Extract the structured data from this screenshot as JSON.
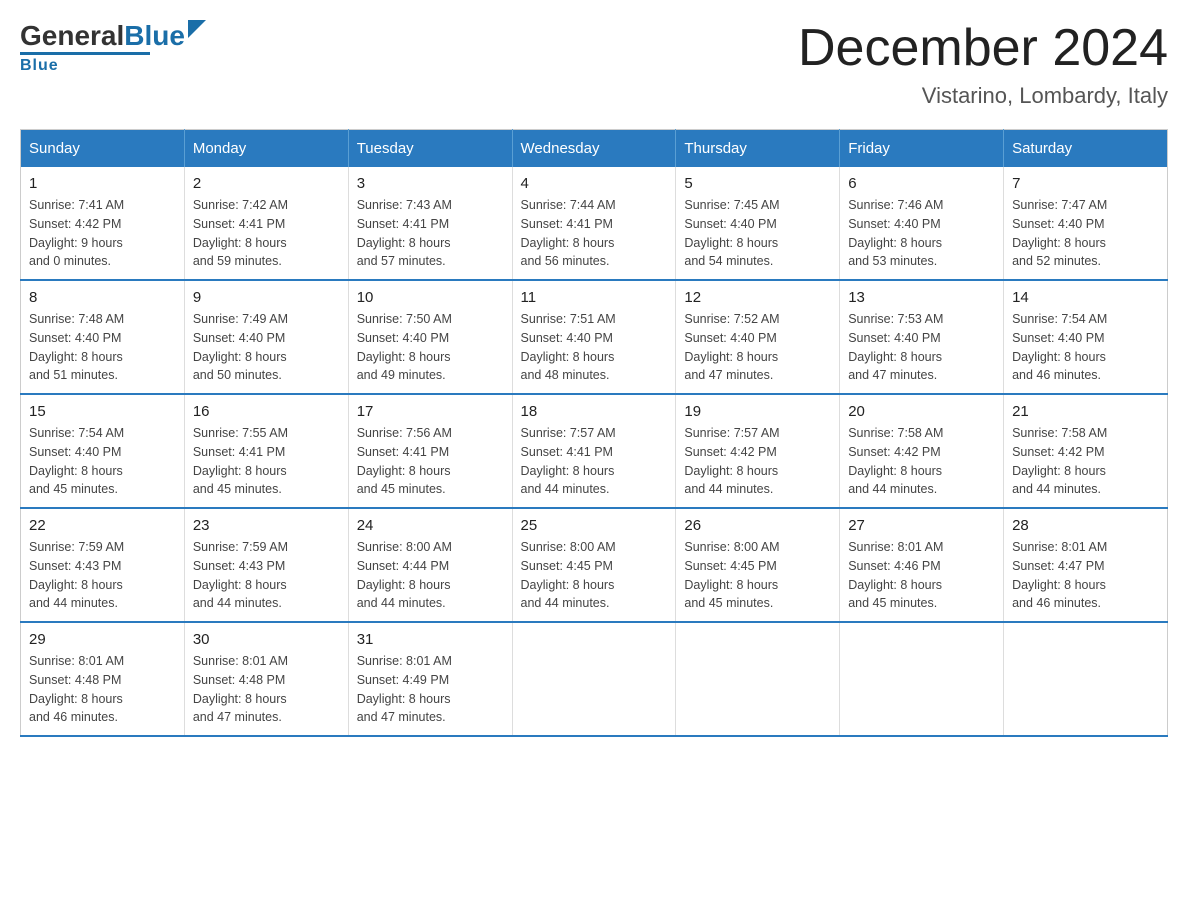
{
  "logo": {
    "general": "General",
    "blue": "Blue"
  },
  "header": {
    "month_year": "December 2024",
    "location": "Vistarino, Lombardy, Italy"
  },
  "days_of_week": [
    "Sunday",
    "Monday",
    "Tuesday",
    "Wednesday",
    "Thursday",
    "Friday",
    "Saturday"
  ],
  "weeks": [
    [
      {
        "day": "1",
        "sunrise": "7:41 AM",
        "sunset": "4:42 PM",
        "daylight": "9 hours and 0 minutes."
      },
      {
        "day": "2",
        "sunrise": "7:42 AM",
        "sunset": "4:41 PM",
        "daylight": "8 hours and 59 minutes."
      },
      {
        "day": "3",
        "sunrise": "7:43 AM",
        "sunset": "4:41 PM",
        "daylight": "8 hours and 57 minutes."
      },
      {
        "day": "4",
        "sunrise": "7:44 AM",
        "sunset": "4:41 PM",
        "daylight": "8 hours and 56 minutes."
      },
      {
        "day": "5",
        "sunrise": "7:45 AM",
        "sunset": "4:40 PM",
        "daylight": "8 hours and 54 minutes."
      },
      {
        "day": "6",
        "sunrise": "7:46 AM",
        "sunset": "4:40 PM",
        "daylight": "8 hours and 53 minutes."
      },
      {
        "day": "7",
        "sunrise": "7:47 AM",
        "sunset": "4:40 PM",
        "daylight": "8 hours and 52 minutes."
      }
    ],
    [
      {
        "day": "8",
        "sunrise": "7:48 AM",
        "sunset": "4:40 PM",
        "daylight": "8 hours and 51 minutes."
      },
      {
        "day": "9",
        "sunrise": "7:49 AM",
        "sunset": "4:40 PM",
        "daylight": "8 hours and 50 minutes."
      },
      {
        "day": "10",
        "sunrise": "7:50 AM",
        "sunset": "4:40 PM",
        "daylight": "8 hours and 49 minutes."
      },
      {
        "day": "11",
        "sunrise": "7:51 AM",
        "sunset": "4:40 PM",
        "daylight": "8 hours and 48 minutes."
      },
      {
        "day": "12",
        "sunrise": "7:52 AM",
        "sunset": "4:40 PM",
        "daylight": "8 hours and 47 minutes."
      },
      {
        "day": "13",
        "sunrise": "7:53 AM",
        "sunset": "4:40 PM",
        "daylight": "8 hours and 47 minutes."
      },
      {
        "day": "14",
        "sunrise": "7:54 AM",
        "sunset": "4:40 PM",
        "daylight": "8 hours and 46 minutes."
      }
    ],
    [
      {
        "day": "15",
        "sunrise": "7:54 AM",
        "sunset": "4:40 PM",
        "daylight": "8 hours and 45 minutes."
      },
      {
        "day": "16",
        "sunrise": "7:55 AM",
        "sunset": "4:41 PM",
        "daylight": "8 hours and 45 minutes."
      },
      {
        "day": "17",
        "sunrise": "7:56 AM",
        "sunset": "4:41 PM",
        "daylight": "8 hours and 45 minutes."
      },
      {
        "day": "18",
        "sunrise": "7:57 AM",
        "sunset": "4:41 PM",
        "daylight": "8 hours and 44 minutes."
      },
      {
        "day": "19",
        "sunrise": "7:57 AM",
        "sunset": "4:42 PM",
        "daylight": "8 hours and 44 minutes."
      },
      {
        "day": "20",
        "sunrise": "7:58 AM",
        "sunset": "4:42 PM",
        "daylight": "8 hours and 44 minutes."
      },
      {
        "day": "21",
        "sunrise": "7:58 AM",
        "sunset": "4:42 PM",
        "daylight": "8 hours and 44 minutes."
      }
    ],
    [
      {
        "day": "22",
        "sunrise": "7:59 AM",
        "sunset": "4:43 PM",
        "daylight": "8 hours and 44 minutes."
      },
      {
        "day": "23",
        "sunrise": "7:59 AM",
        "sunset": "4:43 PM",
        "daylight": "8 hours and 44 minutes."
      },
      {
        "day": "24",
        "sunrise": "8:00 AM",
        "sunset": "4:44 PM",
        "daylight": "8 hours and 44 minutes."
      },
      {
        "day": "25",
        "sunrise": "8:00 AM",
        "sunset": "4:45 PM",
        "daylight": "8 hours and 44 minutes."
      },
      {
        "day": "26",
        "sunrise": "8:00 AM",
        "sunset": "4:45 PM",
        "daylight": "8 hours and 45 minutes."
      },
      {
        "day": "27",
        "sunrise": "8:01 AM",
        "sunset": "4:46 PM",
        "daylight": "8 hours and 45 minutes."
      },
      {
        "day": "28",
        "sunrise": "8:01 AM",
        "sunset": "4:47 PM",
        "daylight": "8 hours and 46 minutes."
      }
    ],
    [
      {
        "day": "29",
        "sunrise": "8:01 AM",
        "sunset": "4:48 PM",
        "daylight": "8 hours and 46 minutes."
      },
      {
        "day": "30",
        "sunrise": "8:01 AM",
        "sunset": "4:48 PM",
        "daylight": "8 hours and 47 minutes."
      },
      {
        "day": "31",
        "sunrise": "8:01 AM",
        "sunset": "4:49 PM",
        "daylight": "8 hours and 47 minutes."
      },
      null,
      null,
      null,
      null
    ]
  ]
}
